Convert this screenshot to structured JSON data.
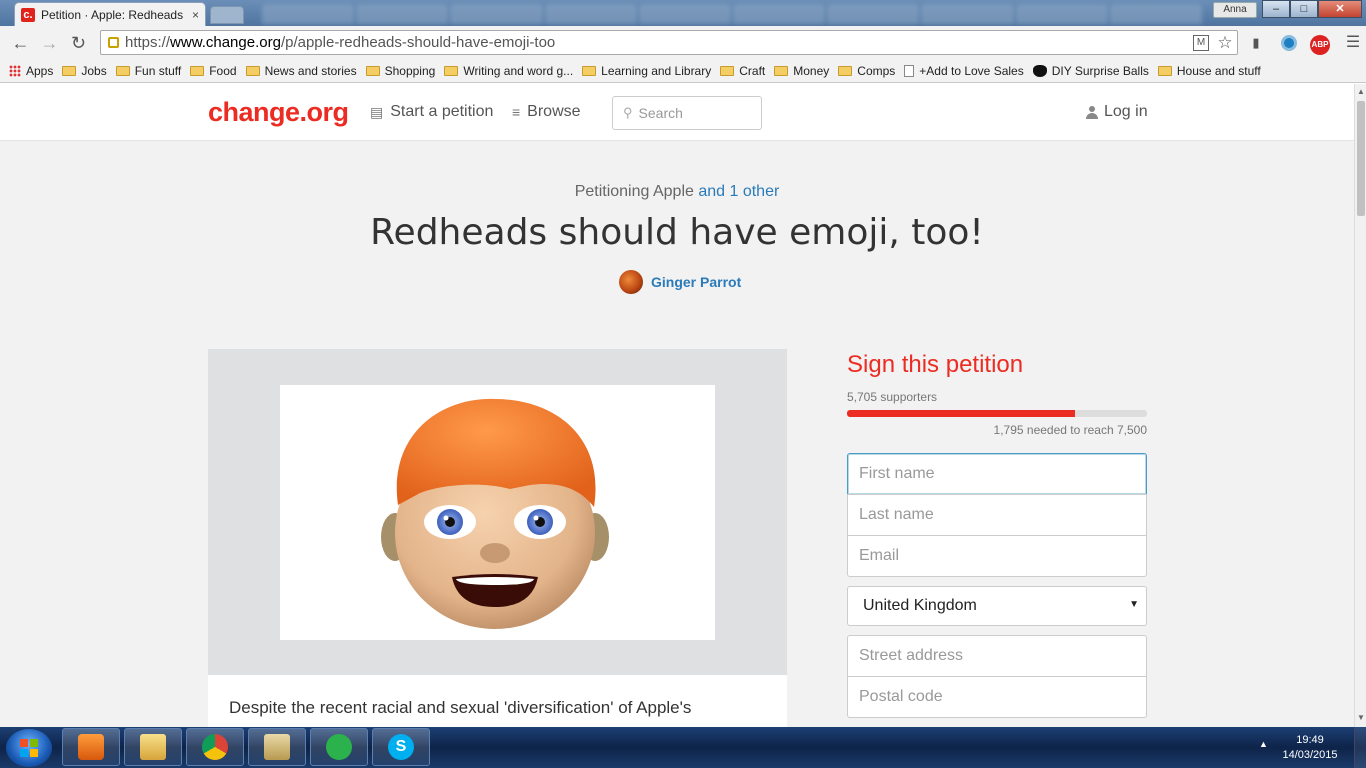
{
  "browser": {
    "tab_title": "Petition · Apple: Redheads",
    "tab_close": "×",
    "favicon_letter": "c.",
    "user_name": "Anna",
    "url_scheme": "https://",
    "url_host": "www.change.org",
    "url_path": "/p/apple-redheads-should-have-emoji-too",
    "ext_abp": "ABP",
    "bookmarks": [
      {
        "label": "Apps",
        "icon": "apps-grid-icon"
      },
      {
        "label": "Jobs",
        "icon": "folder-icon"
      },
      {
        "label": "Fun stuff",
        "icon": "folder-icon"
      },
      {
        "label": "Food",
        "icon": "folder-icon"
      },
      {
        "label": "News and stories",
        "icon": "folder-icon"
      },
      {
        "label": "Shopping",
        "icon": "folder-icon"
      },
      {
        "label": "Writing and word g...",
        "icon": "folder-icon"
      },
      {
        "label": "Learning and Library",
        "icon": "folder-icon"
      },
      {
        "label": "Craft",
        "icon": "folder-icon"
      },
      {
        "label": "Money",
        "icon": "folder-icon"
      },
      {
        "label": "Comps",
        "icon": "folder-icon"
      },
      {
        "label": "+Add to Love Sales",
        "icon": "page-icon"
      },
      {
        "label": "DIY Surprise Balls",
        "icon": "bookmark-favicon"
      },
      {
        "label": "House and stuff",
        "icon": "folder-icon"
      }
    ]
  },
  "site": {
    "logo": "change.org",
    "nav_start": "Start a petition",
    "nav_browse": "Browse",
    "search_placeholder": "Search",
    "login": "Log in",
    "accent_color": "#ec2c22",
    "link_color": "#2b7bb9"
  },
  "petition": {
    "petitioning_prefix": "Petitioning Apple",
    "petitioning_more": "and 1 other",
    "title": "Redheads should have emoji, too!",
    "author": "Ginger Parrot",
    "description_start": "Despite the recent racial and sexual 'diversification' of Apple's"
  },
  "sign": {
    "title": "Sign this petition",
    "supporters": "5,705 supporters",
    "progress_fraction": 0.76,
    "needed": "1,795 needed to reach 7,500",
    "first_name_placeholder": "First name",
    "last_name_placeholder": "Last name",
    "email_placeholder": "Email",
    "country": "United Kingdom",
    "street_placeholder": "Street address",
    "postal_placeholder": "Postal code"
  },
  "taskbar": {
    "time": "19:49",
    "date": "14/03/2015"
  }
}
